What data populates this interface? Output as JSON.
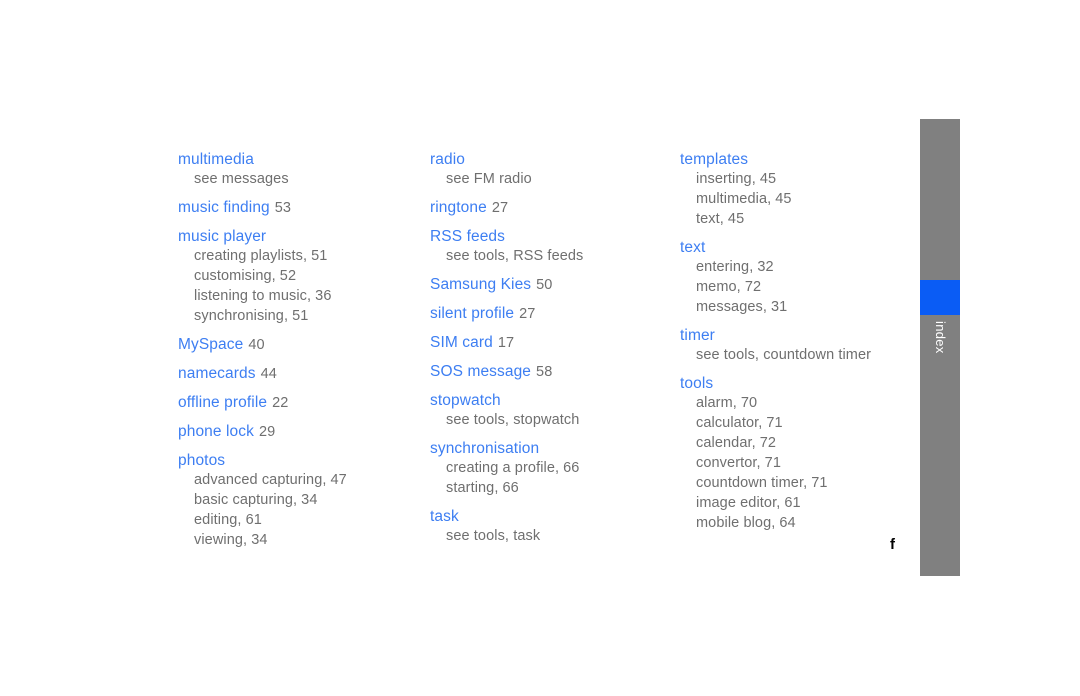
{
  "document": {
    "type": "index",
    "page_marker": "f",
    "side_tab": {
      "label": "index",
      "bar_color": "#808080",
      "highlight_color": "#0a5cf5",
      "label_color": "#ffffff"
    },
    "colors": {
      "heading": "#3d7ef2",
      "subitem": "#6f6f6f",
      "page_number": "#6f6f6f",
      "background": "#ffffff"
    }
  },
  "columns": [
    {
      "entries": [
        {
          "term": "multimedia",
          "page": "",
          "subs": [
            {
              "text": "see messages",
              "page": ""
            }
          ]
        },
        {
          "term": "music finding",
          "page": "53",
          "subs": []
        },
        {
          "term": "music player",
          "page": "",
          "subs": [
            {
              "text": "creating playlists,",
              "page": "51"
            },
            {
              "text": "customising,",
              "page": "52"
            },
            {
              "text": "listening to music,",
              "page": "36"
            },
            {
              "text": "synchronising,",
              "page": "51"
            }
          ]
        },
        {
          "term": "MySpace",
          "page": "40",
          "subs": []
        },
        {
          "term": "namecards",
          "page": "44",
          "subs": []
        },
        {
          "term": "offline profile",
          "page": "22",
          "subs": []
        },
        {
          "term": "phone lock",
          "page": "29",
          "subs": []
        },
        {
          "term": "photos",
          "page": "",
          "subs": [
            {
              "text": "advanced capturing,",
              "page": "47"
            },
            {
              "text": "basic capturing,",
              "page": "34"
            },
            {
              "text": "editing,",
              "page": "61"
            },
            {
              "text": "viewing,",
              "page": "34"
            }
          ]
        }
      ]
    },
    {
      "entries": [
        {
          "term": "radio",
          "page": "",
          "subs": [
            {
              "text": "see FM radio",
              "page": ""
            }
          ]
        },
        {
          "term": "ringtone",
          "page": "27",
          "subs": []
        },
        {
          "term": "RSS feeds",
          "page": "",
          "subs": [
            {
              "text": "see tools, RSS feeds",
              "page": ""
            }
          ]
        },
        {
          "term": "Samsung Kies",
          "page": "50",
          "subs": []
        },
        {
          "term": "silent profile",
          "page": "27",
          "subs": []
        },
        {
          "term": "SIM card",
          "page": "17",
          "subs": []
        },
        {
          "term": "SOS message",
          "page": "58",
          "subs": []
        },
        {
          "term": "stopwatch",
          "page": "",
          "subs": [
            {
              "text": "see tools, stopwatch",
              "page": ""
            }
          ]
        },
        {
          "term": "synchronisation",
          "page": "",
          "subs": [
            {
              "text": "creating a profile,",
              "page": "66"
            },
            {
              "text": "starting,",
              "page": "66"
            }
          ]
        },
        {
          "term": "task",
          "page": "",
          "subs": [
            {
              "text": "see tools, task",
              "page": ""
            }
          ]
        }
      ]
    },
    {
      "entries": [
        {
          "term": "templates",
          "page": "",
          "subs": [
            {
              "text": "inserting,",
              "page": "45"
            },
            {
              "text": "multimedia,",
              "page": "45"
            },
            {
              "text": "text,",
              "page": "45"
            }
          ]
        },
        {
          "term": "text",
          "page": "",
          "subs": [
            {
              "text": "entering,",
              "page": "32"
            },
            {
              "text": "memo,",
              "page": "72"
            },
            {
              "text": "messages,",
              "page": "31"
            }
          ]
        },
        {
          "term": "timer",
          "page": "",
          "subs": [
            {
              "text": "see tools, countdown timer",
              "page": ""
            }
          ]
        },
        {
          "term": "tools",
          "page": "",
          "subs": [
            {
              "text": "alarm,",
              "page": "70"
            },
            {
              "text": "calculator,",
              "page": "71"
            },
            {
              "text": "calendar,",
              "page": "72"
            },
            {
              "text": "convertor,",
              "page": "71"
            },
            {
              "text": "countdown timer,",
              "page": "71"
            },
            {
              "text": "image editor,",
              "page": "61"
            },
            {
              "text": "mobile blog,",
              "page": "64"
            }
          ]
        }
      ]
    }
  ]
}
